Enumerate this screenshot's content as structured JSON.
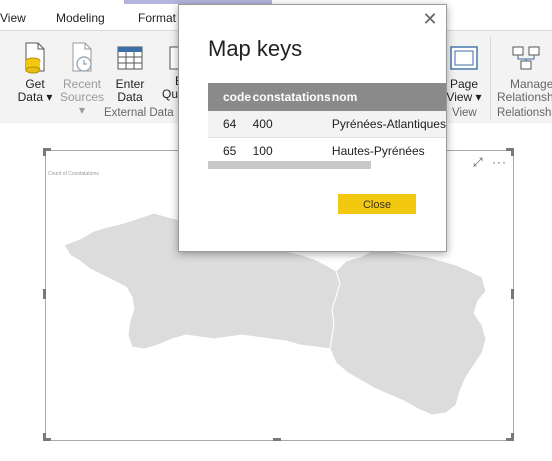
{
  "ribbon_tabs": {
    "view": "View",
    "modeling": "Modeling",
    "format": "Format"
  },
  "ribbon": {
    "get_data": [
      "Get",
      "Data ▾"
    ],
    "recent_sources": [
      "Recent",
      "Sources ▾"
    ],
    "enter_data": [
      "Enter",
      "Data"
    ],
    "edit_queries_partial": [
      "E",
      "Qu"
    ],
    "page_view": [
      "Page",
      "View ▾"
    ],
    "manage_relationships": [
      "Manage",
      "Relationsh"
    ],
    "group_external_data": "External Data",
    "group_view": "View",
    "group_relationships": "Relationsh"
  },
  "visual": {
    "title": "Count of Constatations"
  },
  "dialog": {
    "title": "Map keys",
    "columns": [
      "code",
      "constatations",
      "nom"
    ],
    "rows": [
      [
        "64",
        "400",
        "Pyrénées-Atlantiques"
      ],
      [
        "65",
        "100",
        "Hautes-Pyrénées"
      ]
    ],
    "close_label": "Close"
  },
  "colors": {
    "accent_yellow": "#f2c811",
    "table_header": "#8a8a8a",
    "map_fill": "#dcdcdc"
  }
}
